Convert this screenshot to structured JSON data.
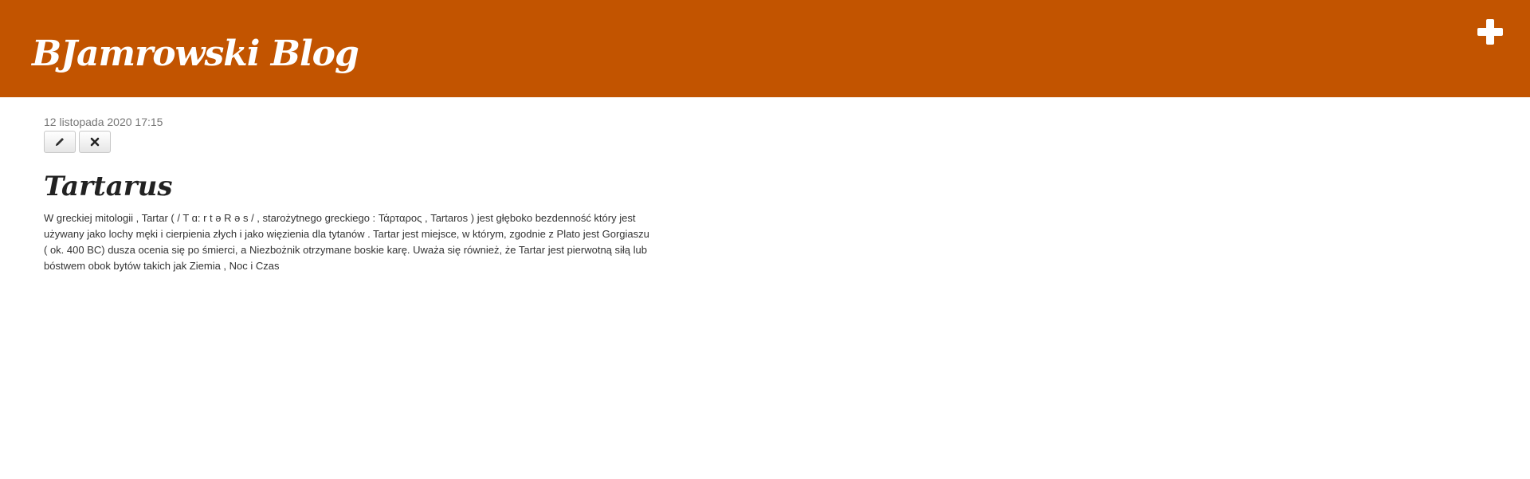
{
  "header": {
    "brand": "BJamrowski Blog",
    "add_icon": "plus-icon"
  },
  "post": {
    "date": "12 listopada 2020 17:15",
    "edit_icon": "pencil-icon",
    "delete_icon": "close-icon",
    "title": "Tartarus",
    "body": "W greckiej mitologii , Tartar ( / T ɑ: r t ə R ə s / , starożytnego greckiego : Τάρταρος , Tartaros ) jest głęboko bezdenność który jest używany jako lochy męki i cierpienia złych i jako więzienia dla tytanów . Tartar jest miejsce, w którym, zgodnie z Plato jest Gorgiaszu ( ok. 400 BC) dusza ocenia się po śmierci, a Niezbożnik otrzymane boskie karę. Uważa się również, że Tartar jest pierwotną siłą lub bóstwem obok bytów takich jak Ziemia , Noc i Czas"
  },
  "colors": {
    "header_bg": "#c25400",
    "header_text": "#ffffff",
    "date_text": "#777777",
    "title_text": "#222222",
    "body_text": "#333333"
  }
}
